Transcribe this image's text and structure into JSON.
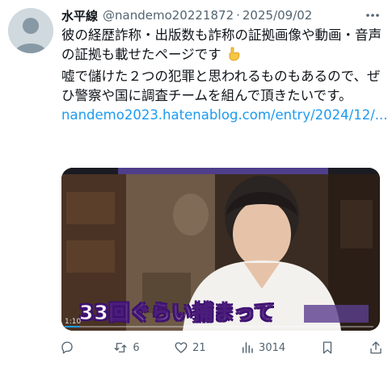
{
  "post": {
    "author_name": "水平線",
    "handle": "@nandemo20221872",
    "separator": "·",
    "date": "2025/09/02",
    "text_line1": "彼の経歴詐称・出版数も詐称の証拠画像や動画・音声の証拠も載せたページです",
    "text_line2": "嘘で儲けた２つの犯罪と思われるものもあるので、ぜひ警察や国に調査チームを組んで頂きたいです。",
    "link": "nandemo2023.hatenablog.com/entry/2024/12/...",
    "emoji_icon": "pointing-down-hand-icon"
  },
  "media": {
    "caption": "33回ぐらい捕まって",
    "timecode": "1:10",
    "progress": 0.05
  },
  "actions": {
    "reply_count": "",
    "repost_count": "6",
    "like_count": "21",
    "views_count": "3014"
  },
  "colors": {
    "link": "#1d9bf0",
    "muted": "#536471",
    "caption_outline": "#3b0f70"
  }
}
